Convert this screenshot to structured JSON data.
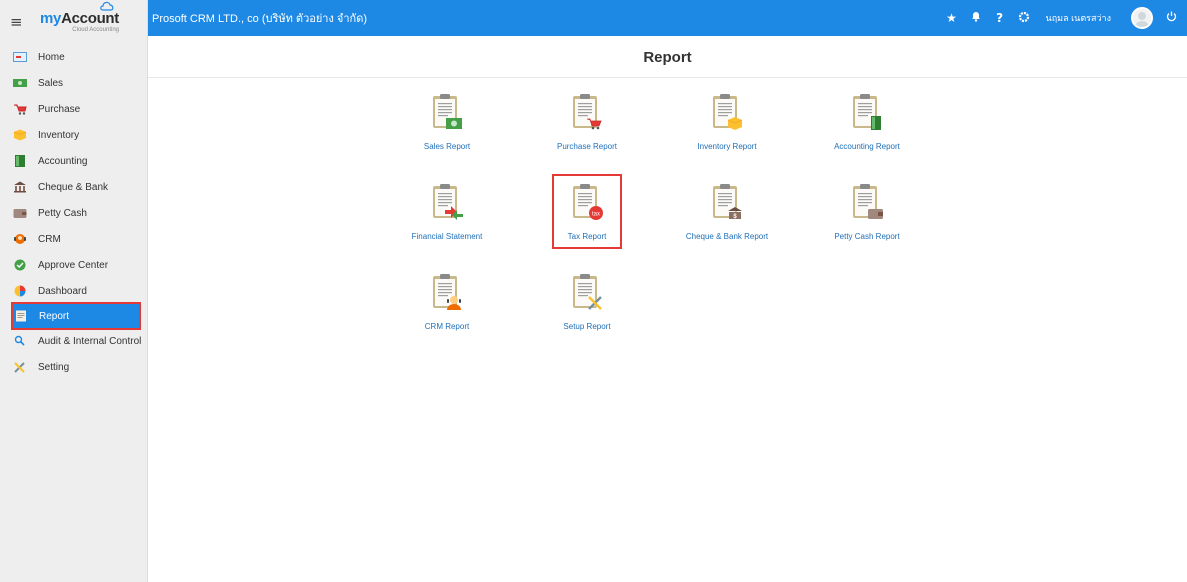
{
  "app": {
    "logo_text_main": "Account",
    "logo_text_prefix": "my",
    "logo_subtitle": "Cloud Accounting"
  },
  "topbar": {
    "company": "Prosoft CRM LTD., co (บริษัท ตัวอย่าง จำกัด)",
    "user_name": "นฤมล เนตรสว่าง",
    "icons": [
      "star-icon",
      "bell-icon",
      "help-icon",
      "gear-icon",
      "avatar",
      "power-icon"
    ]
  },
  "sidebar": {
    "items": [
      {
        "label": "Home",
        "icon": "home-icon"
      },
      {
        "label": "Sales",
        "icon": "sales-icon"
      },
      {
        "label": "Purchase",
        "icon": "cart-icon"
      },
      {
        "label": "Inventory",
        "icon": "box-icon"
      },
      {
        "label": "Accounting",
        "icon": "book-icon"
      },
      {
        "label": "Cheque & Bank",
        "icon": "bank-icon"
      },
      {
        "label": "Petty Cash",
        "icon": "wallet-icon"
      },
      {
        "label": "CRM",
        "icon": "crm-icon"
      },
      {
        "label": "Approve Center",
        "icon": "check-circle-icon"
      },
      {
        "label": "Dashboard",
        "icon": "pie-chart-icon"
      },
      {
        "label": "Report",
        "icon": "report-icon",
        "active": true
      },
      {
        "label": "Audit & Internal Control",
        "icon": "magnifier-icon"
      },
      {
        "label": "Setting",
        "icon": "tools-icon"
      }
    ]
  },
  "main": {
    "title": "Report",
    "reports": [
      {
        "label": "Sales Report",
        "badge": "money"
      },
      {
        "label": "Purchase Report",
        "badge": "cart"
      },
      {
        "label": "Inventory Report",
        "badge": "box"
      },
      {
        "label": "Accounting Report",
        "badge": "book"
      },
      {
        "label": "Financial Statement",
        "badge": "arrows"
      },
      {
        "label": "Tax Report",
        "badge": "tax",
        "highlighted": true
      },
      {
        "label": "Cheque & Bank Report",
        "badge": "bank"
      },
      {
        "label": "Petty Cash Report",
        "badge": "wallet"
      },
      {
        "label": "CRM Report",
        "badge": "person"
      },
      {
        "label": "Setup Report",
        "badge": "tools"
      }
    ],
    "tax_badge_text": "tax"
  },
  "colors": {
    "accent": "#1e88e5",
    "highlight": "#e53935",
    "sidebar_bg": "#eeeeee",
    "link": "#1e6fb8"
  }
}
